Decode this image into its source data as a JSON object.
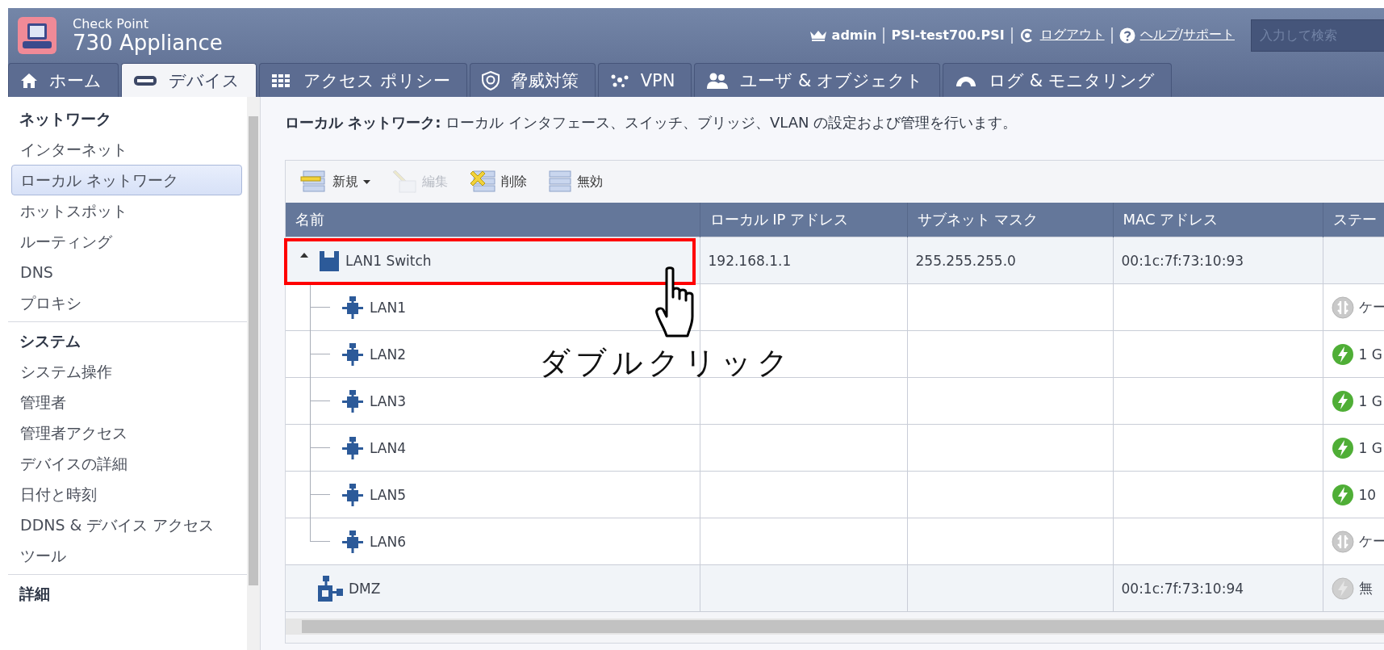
{
  "header": {
    "brand": "Check Point",
    "product": "730 Appliance",
    "user": "admin",
    "host": "PSI-test700.PSI",
    "logout": "ログアウト",
    "help": "ヘルプ",
    "help_separator": "/",
    "support": "サポート",
    "search": {
      "placeholder": "入力して検索"
    }
  },
  "tabs": [
    {
      "label": "ホーム",
      "kind": "home",
      "selected": false
    },
    {
      "label": "デバイス",
      "kind": "device",
      "selected": true
    },
    {
      "label": "アクセス ポリシー",
      "kind": "grid",
      "selected": false
    },
    {
      "label": "脅威対策",
      "kind": "shield",
      "selected": false
    },
    {
      "label": "VPN",
      "kind": "vpn",
      "selected": false
    },
    {
      "label": "ユーザ & オブジェクト",
      "kind": "users",
      "selected": false
    },
    {
      "label": "ログ & モニタリング",
      "kind": "gauge",
      "selected": false
    }
  ],
  "sidebar": {
    "sections": [
      {
        "title": "ネットワーク",
        "items": [
          {
            "label": "インターネット",
            "selected": false
          },
          {
            "label": "ローカル ネットワーク",
            "selected": true
          },
          {
            "label": "ホットスポット",
            "selected": false
          },
          {
            "label": "ルーティング",
            "selected": false
          },
          {
            "label": "DNS",
            "selected": false
          },
          {
            "label": "プロキシ",
            "selected": false
          }
        ]
      },
      {
        "title": "システム",
        "items": [
          {
            "label": "システム操作",
            "selected": false
          },
          {
            "label": "管理者",
            "selected": false
          },
          {
            "label": "管理者アクセス",
            "selected": false
          },
          {
            "label": "デバイスの詳細",
            "selected": false
          },
          {
            "label": "日付と時刻",
            "selected": false
          },
          {
            "label": "DDNS & デバイス アクセス",
            "selected": false
          },
          {
            "label": "ツール",
            "selected": false
          }
        ]
      },
      {
        "title": "詳細"
      }
    ]
  },
  "page": {
    "title": "ローカル ネットワーク:",
    "description": "ローカル インタフェース、スイッチ、ブリッジ、VLAN の設定および管理を行います。"
  },
  "toolbar": [
    {
      "label": "新規",
      "kind": "new",
      "dropdown": true,
      "disabled": false
    },
    {
      "label": "編集",
      "kind": "edit",
      "dropdown": false,
      "disabled": true
    },
    {
      "label": "削除",
      "kind": "delete",
      "dropdown": false,
      "disabled": false
    },
    {
      "label": "無効",
      "kind": "disable",
      "dropdown": false,
      "disabled": false
    }
  ],
  "table": {
    "columns": [
      "名前",
      "ローカル IP アドレス",
      "サブネット マスク",
      "MAC アドレス",
      "ステー"
    ],
    "rows": [
      {
        "name": "LAN1 Switch",
        "kind": "switch",
        "expanded": true,
        "ip": "192.168.1.1",
        "subnet": "255.255.255.0",
        "mac": "00:1c:7f:73:10:93",
        "children": [
          {
            "name": "LAN1",
            "kind": "port",
            "status": {
              "kind": "disconnected",
              "text": "ケー"
            }
          },
          {
            "name": "LAN2",
            "kind": "port",
            "status": {
              "kind": "connected",
              "text": "1 G"
            }
          },
          {
            "name": "LAN3",
            "kind": "port",
            "status": {
              "kind": "connected",
              "text": "1 G"
            }
          },
          {
            "name": "LAN4",
            "kind": "port",
            "status": {
              "kind": "connected",
              "text": "1 G"
            }
          },
          {
            "name": "LAN5",
            "kind": "port",
            "status": {
              "kind": "connected",
              "text": "10"
            }
          },
          {
            "name": "LAN6",
            "kind": "port",
            "status": {
              "kind": "disconnected",
              "text": "ケー"
            }
          }
        ]
      },
      {
        "name": "DMZ",
        "kind": "dmz",
        "mac": "00:1c:7f:73:10:94",
        "status": {
          "kind": "disabled",
          "text": "無"
        }
      }
    ]
  },
  "annotation": {
    "caption": "ダブルクリック"
  }
}
